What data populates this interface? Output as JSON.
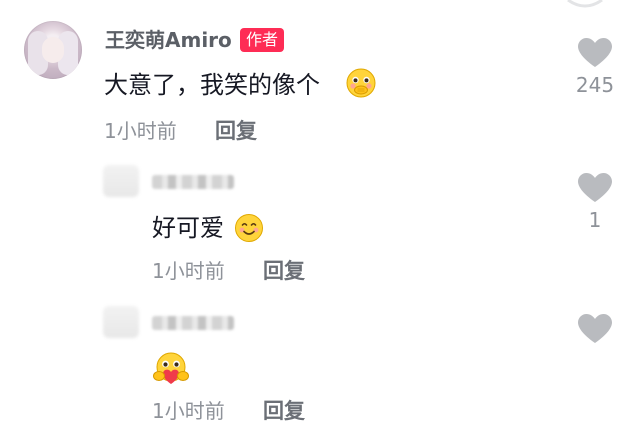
{
  "comments": [
    {
      "author": "王奕萌Amiro",
      "badge": "作者",
      "text": "大意了，我笑的像个",
      "emoji": "shy-face-emoji",
      "time": "1小时前",
      "reply_label": "回复",
      "likes": "245"
    },
    {
      "author": "",
      "text": "好可爱",
      "emoji": "smiling-face-emoji",
      "time": "1小时前",
      "reply_label": "回复",
      "likes": "1"
    },
    {
      "author": "",
      "text": "",
      "emoji": "hug-heart-emoji",
      "time": "1小时前",
      "reply_label": "回复",
      "likes": ""
    }
  ],
  "colors": {
    "badge": "#fe2c55",
    "heart": "#b9bbbf",
    "meta": "#8e9299",
    "text": "#161823"
  }
}
